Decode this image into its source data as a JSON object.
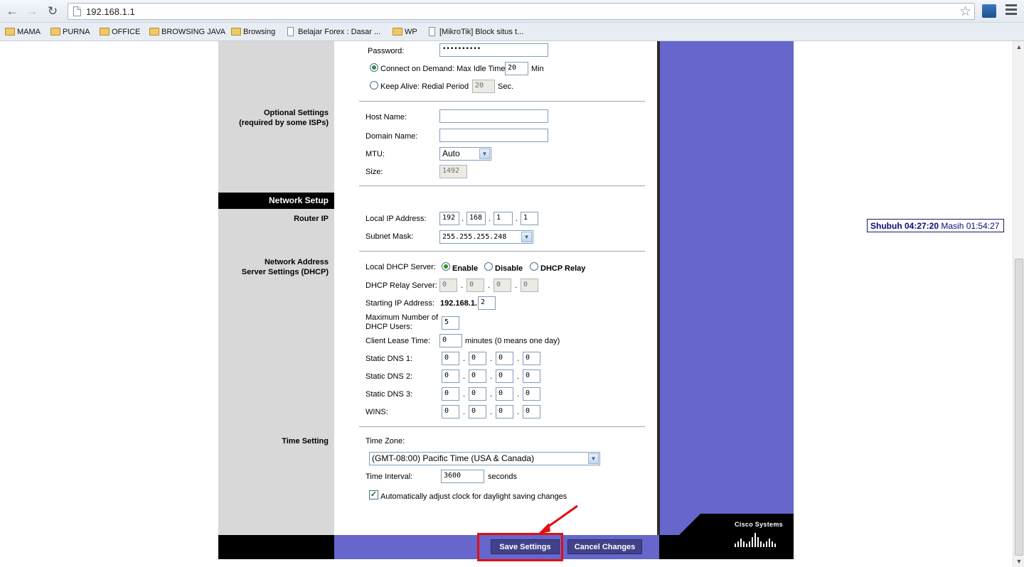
{
  "browser": {
    "url": "192.168.1.1",
    "bookmarks": [
      "MAMA",
      "PURNA",
      "OFFICE",
      "BROWSING JAVA",
      "Browsing",
      "Belajar Forex : Dasar ...",
      "WP",
      "[MikroTik] Block situs t..."
    ]
  },
  "pppoe": {
    "password_label": "Password:",
    "password_value": "••••••••••",
    "connect_on_demand_label": "Connect on Demand: Max Idle Time",
    "max_idle_value": "20",
    "max_idle_unit": "Min",
    "keep_alive_label": "Keep Alive: Redial Period",
    "redial_value": "20",
    "redial_unit": "Sec."
  },
  "optional": {
    "section_line1": "Optional Settings",
    "section_line2": "(required by some ISPs)",
    "host_name_label": "Host Name:",
    "domain_name_label": "Domain Name:",
    "mtu_label": "MTU:",
    "mtu_value": "Auto",
    "size_label": "Size:",
    "size_value": "1492"
  },
  "network_setup": {
    "bar_title": "Network Setup",
    "router_ip_label": "Router IP",
    "local_ip_label": "Local IP Address:",
    "ip": [
      "192",
      "168",
      "1",
      "1"
    ],
    "subnet_label": "Subnet Mask:",
    "subnet_value": "255.255.255.248"
  },
  "dhcp": {
    "section_line1": "Network Address",
    "section_line2": "Server Settings (DHCP)",
    "server_label": "Local DHCP Server:",
    "enable": "Enable",
    "disable": "Disable",
    "relay": "DHCP Relay",
    "relay_server_label": "DHCP Relay Server:",
    "relay_ip": [
      "0",
      "0",
      "0",
      "0"
    ],
    "start_ip_label": "Starting IP Address:",
    "start_ip_prefix": "192.168.1.",
    "start_ip_value": "2",
    "max_users_line1": "Maximum Number of",
    "max_users_line2": "DHCP Users:",
    "max_users_value": "5",
    "lease_label": "Client Lease Time:",
    "lease_value": "0",
    "lease_note": "minutes (0 means one day)",
    "dns1_label": "Static DNS 1:",
    "dns2_label": "Static DNS 2:",
    "dns3_label": "Static DNS 3:",
    "wins_label": "WINS:",
    "dns1": [
      "0",
      "0",
      "0",
      "0"
    ],
    "dns2": [
      "0",
      "0",
      "0",
      "0"
    ],
    "dns3": [
      "0",
      "0",
      "0",
      "0"
    ],
    "wins": [
      "0",
      "0",
      "0",
      "0"
    ]
  },
  "time": {
    "section_label": "Time Setting",
    "zone_label": "Time Zone:",
    "zone_value": "(GMT-08:00) Pacific Time (USA & Canada)",
    "interval_label": "Time Interval:",
    "interval_value": "3600",
    "interval_unit": "seconds",
    "dst_label": "Automatically adjust clock for daylight saving changes"
  },
  "actions": {
    "save": "Save Settings",
    "cancel": "Cancel Changes"
  },
  "brand": "Cisco Systems",
  "prayer": {
    "name_time": "Shubuh 04:27:20",
    "remaining": "Masih 01:54:27"
  }
}
